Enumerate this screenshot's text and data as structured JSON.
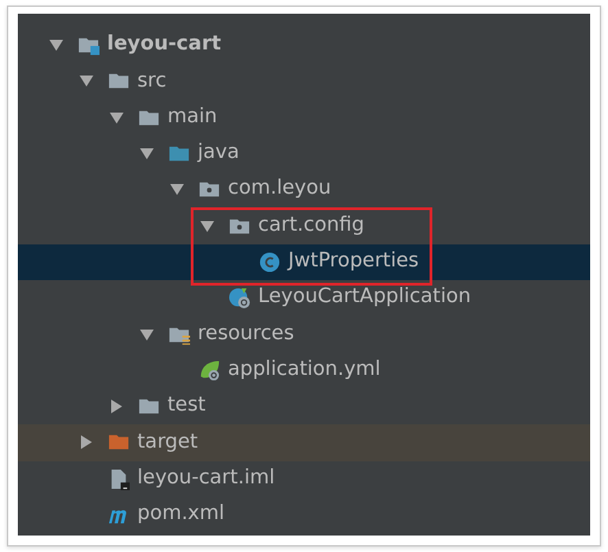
{
  "tree": [
    {
      "label": "leyou-cart",
      "kind": "module",
      "expanded": true,
      "children": [
        {
          "label": "src",
          "kind": "folder",
          "expanded": true,
          "children": [
            {
              "label": "main",
              "kind": "folder",
              "expanded": true,
              "children": [
                {
                  "label": "java",
                  "kind": "source-folder",
                  "expanded": true,
                  "children": [
                    {
                      "label": "com.leyou",
                      "kind": "package",
                      "expanded": true,
                      "children": [
                        {
                          "label": "cart.config",
                          "kind": "package",
                          "expanded": true,
                          "boxed": true,
                          "children": [
                            {
                              "label": "JwtProperties",
                              "kind": "class",
                              "selected": true,
                              "boxed": true
                            }
                          ]
                        },
                        {
                          "label": "LeyouCartApplication",
                          "kind": "spring-class",
                          "selected": false
                        }
                      ]
                    }
                  ]
                },
                {
                  "label": "resources",
                  "kind": "resources-folder",
                  "expanded": true,
                  "children": [
                    {
                      "label": "application.yml",
                      "kind": "yml",
                      "selected": false
                    }
                  ]
                }
              ]
            },
            {
              "label": "test",
              "kind": "folder",
              "expanded": false
            }
          ]
        },
        {
          "label": "target",
          "kind": "excluded-folder",
          "expanded": false,
          "excluded": true
        },
        {
          "label": "leyou-cart.iml",
          "kind": "iml",
          "selected": false
        },
        {
          "label": "pom.xml",
          "kind": "maven",
          "selected": false
        }
      ]
    }
  ]
}
